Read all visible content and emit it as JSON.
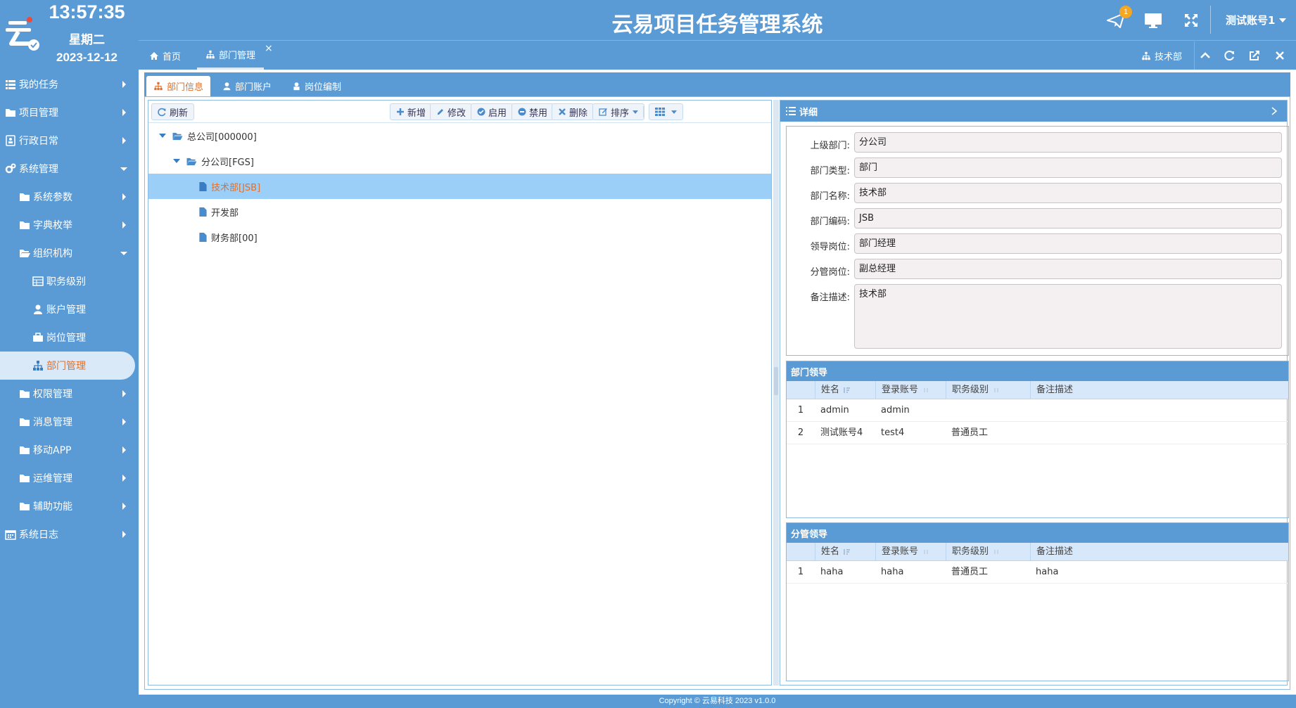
{
  "clock": {
    "time": "13:57:35",
    "weekday": "星期二",
    "date": "2023-12-12"
  },
  "app": {
    "title": "云易项目任务管理系统"
  },
  "header": {
    "notification_count": "1",
    "user": "测试账号1"
  },
  "sidebar": {
    "items": [
      {
        "label": "我的任务"
      },
      {
        "label": "项目管理"
      },
      {
        "label": "行政日常"
      },
      {
        "label": "系统管理"
      },
      {
        "label": "系统参数"
      },
      {
        "label": "字典枚举"
      },
      {
        "label": "组织机构"
      },
      {
        "label": "职务级别"
      },
      {
        "label": "账户管理"
      },
      {
        "label": "岗位管理"
      },
      {
        "label": "部门管理"
      },
      {
        "label": "权限管理"
      },
      {
        "label": "消息管理"
      },
      {
        "label": "移动APP"
      },
      {
        "label": "运维管理"
      },
      {
        "label": "辅助功能"
      },
      {
        "label": "系统日志"
      }
    ]
  },
  "page_tabs": {
    "home": "首页",
    "current": "部门管理",
    "close": "×",
    "breadcrumb": "技术部"
  },
  "sub_tabs": [
    "部门信息",
    "部门账户",
    "岗位编制"
  ],
  "toolbar": {
    "refresh": "刷新",
    "add": "新增",
    "edit": "修改",
    "enable": "启用",
    "disable": "禁用",
    "delete": "删除",
    "sort": "排序"
  },
  "tree": [
    {
      "label": "总公司[000000]"
    },
    {
      "label": "分公司[FGS]"
    },
    {
      "label": "技术部[JSB]"
    },
    {
      "label": "开发部"
    },
    {
      "label": "财务部[00]"
    }
  ],
  "detail": {
    "title": "详细",
    "fields": [
      {
        "label": "上级部门:",
        "value": "分公司"
      },
      {
        "label": "部门类型:",
        "value": "部门"
      },
      {
        "label": "部门名称:",
        "value": "技术部"
      },
      {
        "label": "部门编码:",
        "value": "JSB"
      },
      {
        "label": "领导岗位:",
        "value": "部门经理"
      },
      {
        "label": "分管岗位:",
        "value": "副总经理"
      },
      {
        "label": "备注描述:",
        "value": "技术部"
      }
    ]
  },
  "leaders": {
    "title": "部门领导",
    "columns": [
      "姓名",
      "登录账号",
      "职务级别",
      "备注描述"
    ],
    "rows": [
      {
        "num": "1",
        "name": "admin",
        "account": "admin",
        "level": "",
        "note": ""
      },
      {
        "num": "2",
        "name": "测试账号4",
        "account": "test4",
        "level": "普通员工",
        "note": ""
      }
    ]
  },
  "branch_leaders": {
    "title": "分管领导",
    "columns": [
      "姓名",
      "登录账号",
      "职务级别",
      "备注描述"
    ],
    "rows": [
      {
        "num": "1",
        "name": "haha",
        "account": "haha",
        "level": "普通员工",
        "note": "haha"
      }
    ]
  },
  "footer": {
    "copyright": "Copyright © 云易科技 2023 v1.0.0"
  }
}
